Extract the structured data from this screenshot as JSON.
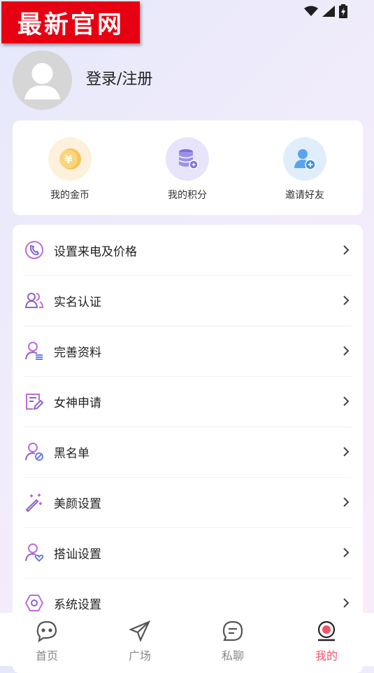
{
  "brand_badge": "最新官网",
  "profile": {
    "login_label": "登录/注册"
  },
  "stats": [
    {
      "label": "我的金币",
      "icon": "coin-icon"
    },
    {
      "label": "我的积分",
      "icon": "points-database-icon"
    },
    {
      "label": "邀请好友",
      "icon": "invite-user-icon"
    }
  ],
  "menu": [
    {
      "label": "设置来电及价格",
      "icon": "phone-call-icon"
    },
    {
      "label": "实名认证",
      "icon": "users-icon"
    },
    {
      "label": "完善资料",
      "icon": "profile-edit-icon"
    },
    {
      "label": "女神申请",
      "icon": "form-edit-icon"
    },
    {
      "label": "黑名单",
      "icon": "user-block-icon"
    },
    {
      "label": "美颜设置",
      "icon": "magic-wand-icon"
    },
    {
      "label": "搭讪设置",
      "icon": "user-heart-icon"
    },
    {
      "label": "系统设置",
      "icon": "hex-settings-icon"
    }
  ],
  "tabs": [
    {
      "label": "首页",
      "icon": "chat-bubble-icon",
      "active": false
    },
    {
      "label": "广场",
      "icon": "send-plane-icon",
      "active": false
    },
    {
      "label": "私聊",
      "icon": "message-icon",
      "active": false
    },
    {
      "label": "我的",
      "icon": "profile-icon",
      "active": true
    }
  ],
  "colors": {
    "accent": "#f2536b",
    "badge_red": "#e60012",
    "menu_icon": "#8a63d2"
  }
}
